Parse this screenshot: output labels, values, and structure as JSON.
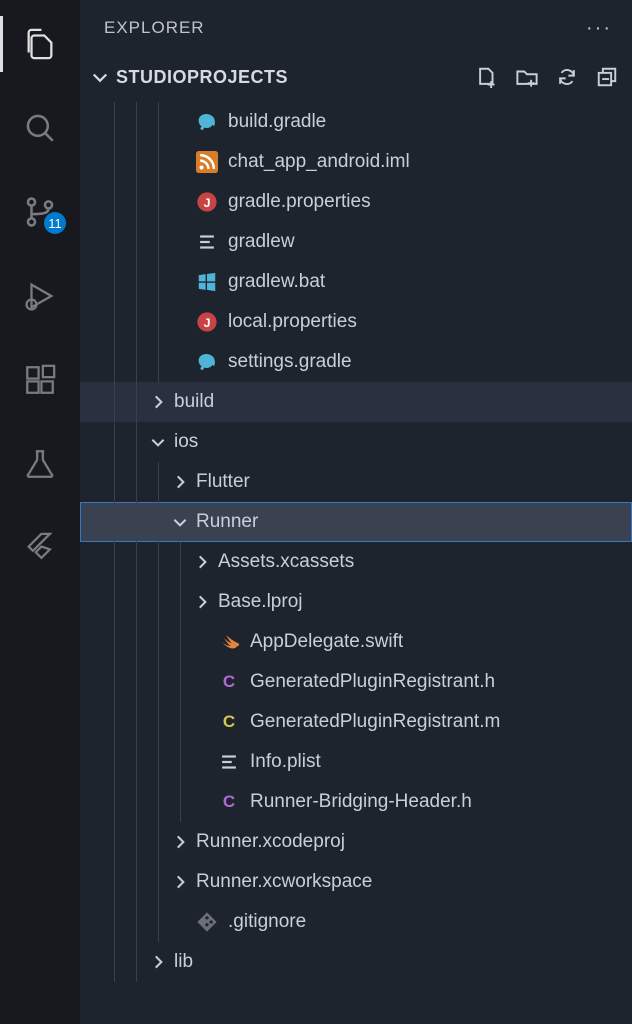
{
  "header": {
    "title": "EXPLORER"
  },
  "section": {
    "title": "STUDIOPROJECTS"
  },
  "activity": {
    "badge_source": "11"
  },
  "tree": [
    {
      "label": "build.gradle",
      "kind": "file",
      "icon": "elephant",
      "indent": 3
    },
    {
      "label": "chat_app_android.iml",
      "kind": "file",
      "icon": "rss",
      "indent": 3
    },
    {
      "label": "gradle.properties",
      "kind": "file",
      "icon": "j-red",
      "indent": 3
    },
    {
      "label": "gradlew",
      "kind": "file",
      "icon": "lines",
      "indent": 3
    },
    {
      "label": "gradlew.bat",
      "kind": "file",
      "icon": "windows",
      "indent": 3
    },
    {
      "label": "local.properties",
      "kind": "file",
      "icon": "j-red",
      "indent": 3
    },
    {
      "label": "settings.gradle",
      "kind": "file",
      "icon": "elephant",
      "indent": 3
    },
    {
      "label": "build",
      "kind": "folder",
      "collapsed": true,
      "indent": 2,
      "hovered": true
    },
    {
      "label": "ios",
      "kind": "folder",
      "collapsed": false,
      "indent": 2
    },
    {
      "label": "Flutter",
      "kind": "folder",
      "collapsed": true,
      "indent": 3
    },
    {
      "label": "Runner",
      "kind": "folder",
      "collapsed": false,
      "indent": 3,
      "selected": true
    },
    {
      "label": "Assets.xcassets",
      "kind": "folder",
      "collapsed": true,
      "indent": 4
    },
    {
      "label": "Base.lproj",
      "kind": "folder",
      "collapsed": true,
      "indent": 4
    },
    {
      "label": "AppDelegate.swift",
      "kind": "file",
      "icon": "swift",
      "indent": 4
    },
    {
      "label": "GeneratedPluginRegistrant.h",
      "kind": "file",
      "icon": "c-purple",
      "indent": 4
    },
    {
      "label": "GeneratedPluginRegistrant.m",
      "kind": "file",
      "icon": "c-yellow",
      "indent": 4
    },
    {
      "label": "Info.plist",
      "kind": "file",
      "icon": "lines",
      "indent": 4
    },
    {
      "label": "Runner-Bridging-Header.h",
      "kind": "file",
      "icon": "c-purple",
      "indent": 4
    },
    {
      "label": "Runner.xcodeproj",
      "kind": "folder",
      "collapsed": true,
      "indent": 3
    },
    {
      "label": "Runner.xcworkspace",
      "kind": "folder",
      "collapsed": true,
      "indent": 3
    },
    {
      "label": ".gitignore",
      "kind": "file",
      "icon": "git",
      "indent": 3
    },
    {
      "label": "lib",
      "kind": "folder",
      "collapsed": true,
      "indent": 2
    }
  ]
}
